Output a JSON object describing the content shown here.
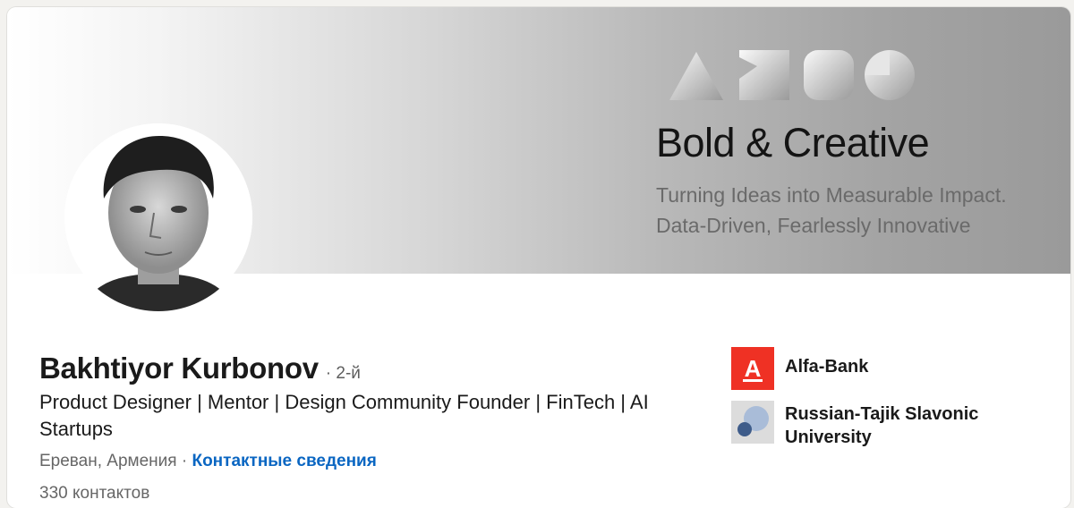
{
  "banner": {
    "title": "Bold & Creative",
    "subtitle_line1": "Turning Ideas into Measurable Impact.",
    "subtitle_line2": "Data-Driven, Fearlessly Innovative"
  },
  "profile": {
    "name": "Bakhtiyor Kurbonov",
    "degree": "· 2-й",
    "headline": "Product Designer | Mentor | Design Community Founder | FinTech | AI Startups",
    "location": "Ереван, Армения",
    "separator": " · ",
    "contact_link": "Контактные сведения",
    "followers": "330 контактов"
  },
  "orgs": [
    {
      "name": "Alfa-Bank",
      "logo_letter": "А",
      "logo_color": "#ef3124"
    },
    {
      "name": "Russian-Tajik Slavonic University",
      "logo_color": "#dcdcdc"
    }
  ],
  "colors": {
    "link": "#0a66c2",
    "alfa_red": "#ef3124"
  }
}
